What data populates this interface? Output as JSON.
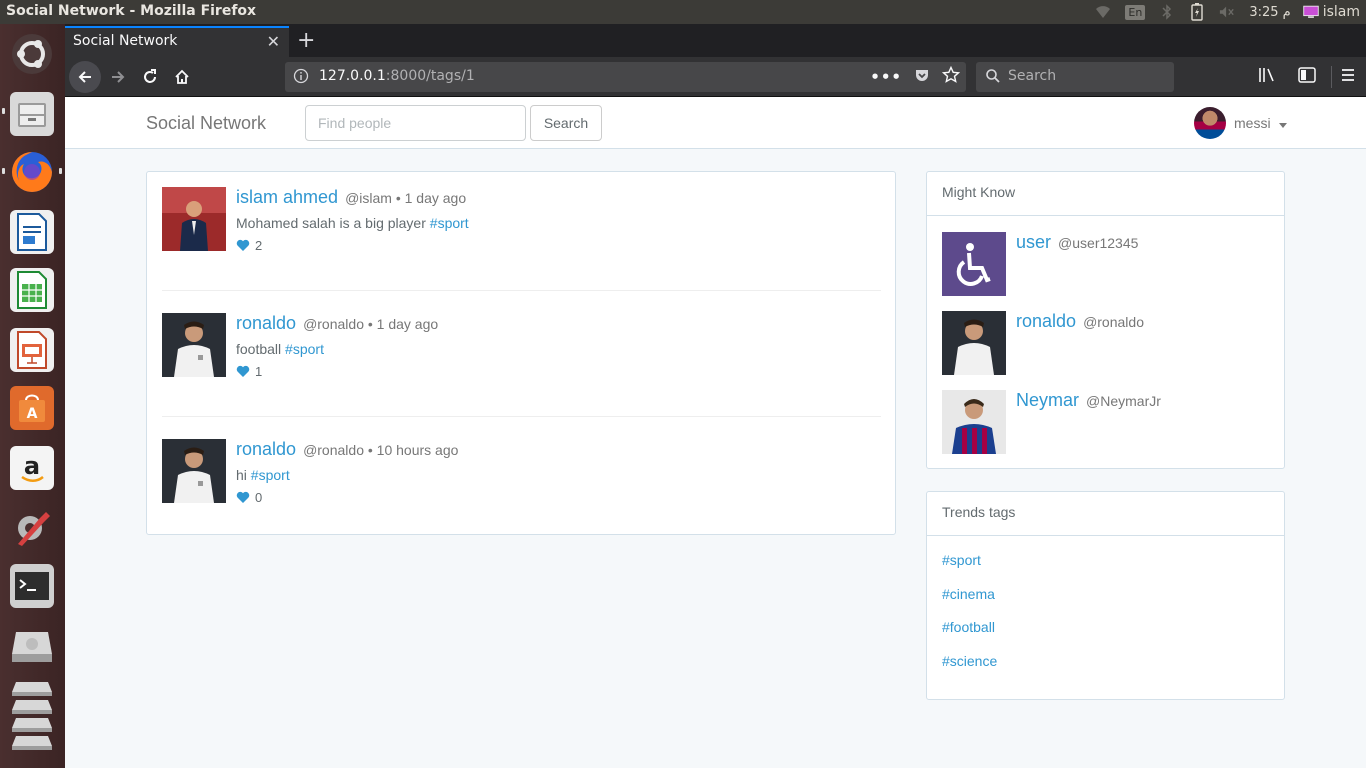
{
  "system": {
    "window_title": "Social Network - Mozilla Firefox",
    "keyboard_layout": "En",
    "clock": "3:25 م",
    "user": "islam"
  },
  "browser": {
    "tab_title": "Social Network",
    "url_host": "127.0.0.1",
    "url_rest": ":8000/tags/1",
    "search_placeholder": "Search"
  },
  "site": {
    "brand": "Social Network",
    "find_placeholder": "Find people",
    "find_button": "Search",
    "current_user": "messi"
  },
  "posts": [
    {
      "name": "islam ahmed",
      "meta": "@islam • 1 day ago",
      "text": "Mohamed salah is a big player",
      "tag": "#sport",
      "likes": "2"
    },
    {
      "name": "ronaldo",
      "meta": "@ronaldo • 1 day ago",
      "text": "football",
      "tag": "#sport",
      "likes": "1"
    },
    {
      "name": "ronaldo",
      "meta": "@ronaldo • 10 hours ago",
      "text": "hi",
      "tag": "#sport",
      "likes": "0"
    }
  ],
  "might_know": {
    "title": "Might Know",
    "people": [
      {
        "name": "user",
        "handle": "@user12345"
      },
      {
        "name": "ronaldo",
        "handle": "@ronaldo"
      },
      {
        "name": "Neymar",
        "handle": "@NeymarJr"
      }
    ]
  },
  "trends": {
    "title": "Trends tags",
    "tags": [
      "#sport",
      "#cinema",
      "#football",
      "#science"
    ]
  },
  "colors": {
    "link": "#3097d1",
    "heart": "#3097d1",
    "accessibility_avatar": "#5d4a8c"
  }
}
